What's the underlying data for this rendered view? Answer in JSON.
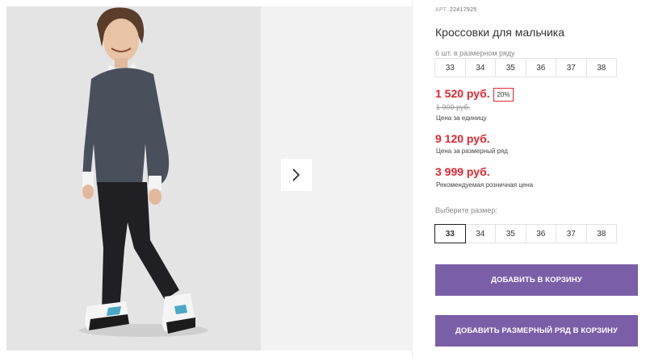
{
  "product": {
    "article_prefix": "АРТ.",
    "article_number": "22417925",
    "title": "Кроссовки для мальчика",
    "row_note": "6 шт. в размерном ряду",
    "row_sizes": [
      "33",
      "34",
      "35",
      "36",
      "37",
      "38"
    ],
    "price": "1 520 руб.",
    "discount": "20%",
    "old_price": "1 900 руб.",
    "unit_price_label": "Цена за единицу",
    "row_price": "9 120 руб.",
    "row_price_label": "Цена за размерный ряд",
    "retail_price": "3 999 руб.",
    "retail_price_label": "Рекомендуемая розничная цена",
    "choose_size_label": "Выберите размер:",
    "selectable_sizes": [
      "33",
      "34",
      "35",
      "36",
      "37",
      "38"
    ],
    "selected_size": "33"
  },
  "actions": {
    "add_to_cart": "Добавить в корзину",
    "add_row_to_cart": "Добавить размерный ряд в корзину"
  },
  "colors": {
    "price": "#e3262f",
    "button": "#7b5ea8",
    "photo_background": "#e6e6e6"
  },
  "icons": {
    "next": "chevron-right-icon"
  }
}
